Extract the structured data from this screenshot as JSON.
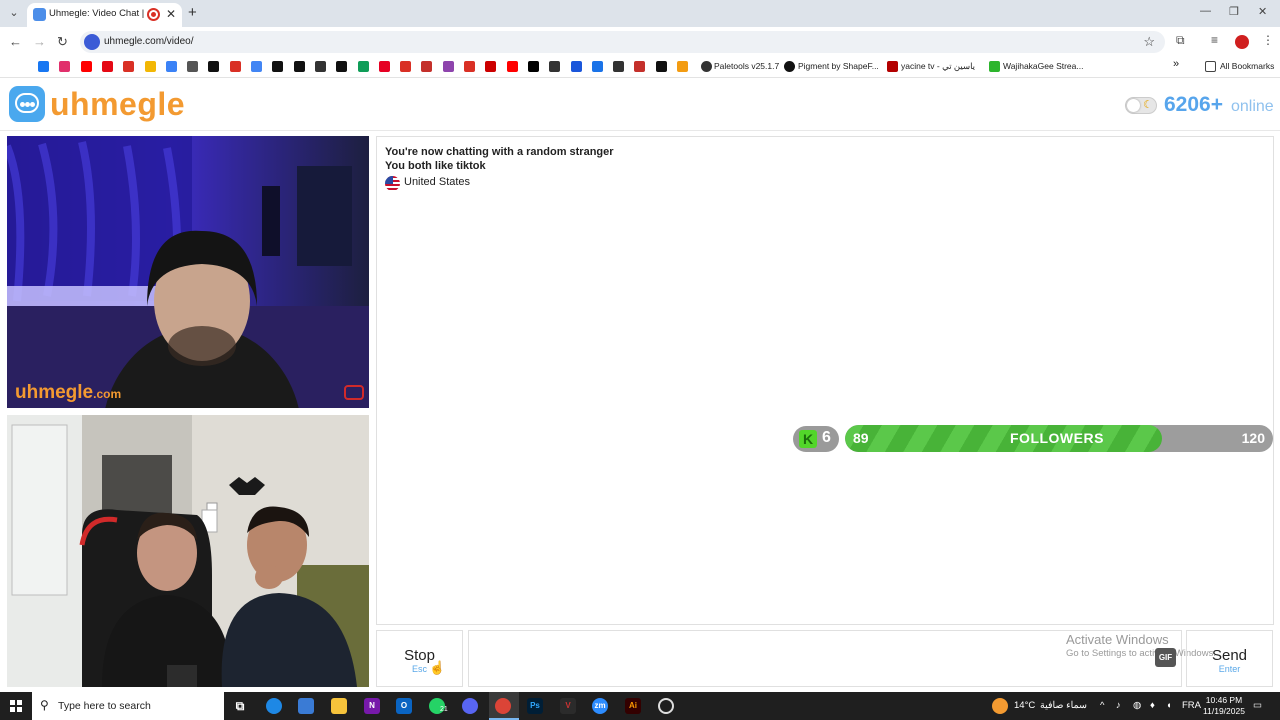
{
  "browser": {
    "tab_title": "Uhmegle: Video Chat | Ran",
    "tab_close": "✕",
    "new_tab": "+",
    "url": "uhmegle.com/video/",
    "bookmarks": [
      {
        "label": "Paletools v25.1.7"
      },
      {
        "label": "Pigment by ShapeF..."
      },
      {
        "label": "yacine tv - ياسين تي"
      },
      {
        "label": "WajihakaGee Strea..."
      },
      {
        "label": "All Bookmarks"
      }
    ],
    "bookmark_colors": [
      "#1877f2",
      "#e1306c",
      "#ff0000",
      "#e50914",
      "#d93025",
      "#f2b705",
      "#3b82f6",
      "#555555",
      "#111111",
      "#d93025",
      "#4285f4",
      "#111111",
      "#111111",
      "#333333",
      "#111111",
      "#0f9d58",
      "#e60023",
      "#d93025",
      "#c4302b",
      "#8e44ad",
      "#d93025",
      "#cc0000",
      "#ff0000",
      "#000000",
      "#333333",
      "#1a56db",
      "#1a73e8",
      "#333333",
      "#c4302b",
      "#111111",
      "#f39c12"
    ]
  },
  "site": {
    "logo_text": "uhmegle",
    "online_count": "6206+",
    "online_label": "online",
    "watermark": "uhmegle",
    "watermark_suffix": ".com"
  },
  "chat": {
    "messages": [
      "You're now chatting with a random stranger",
      "You both like tiktok"
    ],
    "country": "United States"
  },
  "overlay": {
    "level": "6",
    "level_badge": "K",
    "followers_current": "89",
    "followers_label": "FOLLOWERS",
    "followers_goal": "120",
    "progress_fraction": 0.74
  },
  "controls": {
    "stop_label": "Stop",
    "stop_hint": "Esc",
    "send_label": "Send",
    "send_hint": "Enter",
    "gif_label": "GIF",
    "activate_title": "Activate Windows",
    "activate_sub": "Go to Settings to activate Windows."
  },
  "taskbar": {
    "search_placeholder": "Type here to search",
    "whatsapp_badge": "21",
    "weather_temp": "14°C",
    "weather_desc": "سماء صافية",
    "lang": "FRA",
    "time": "10:46 PM",
    "date": "11/19/2025"
  },
  "colors": {
    "brand_orange": "#f39a31",
    "brand_blue": "#57a5ec",
    "progress_green": "#5bc84a"
  }
}
